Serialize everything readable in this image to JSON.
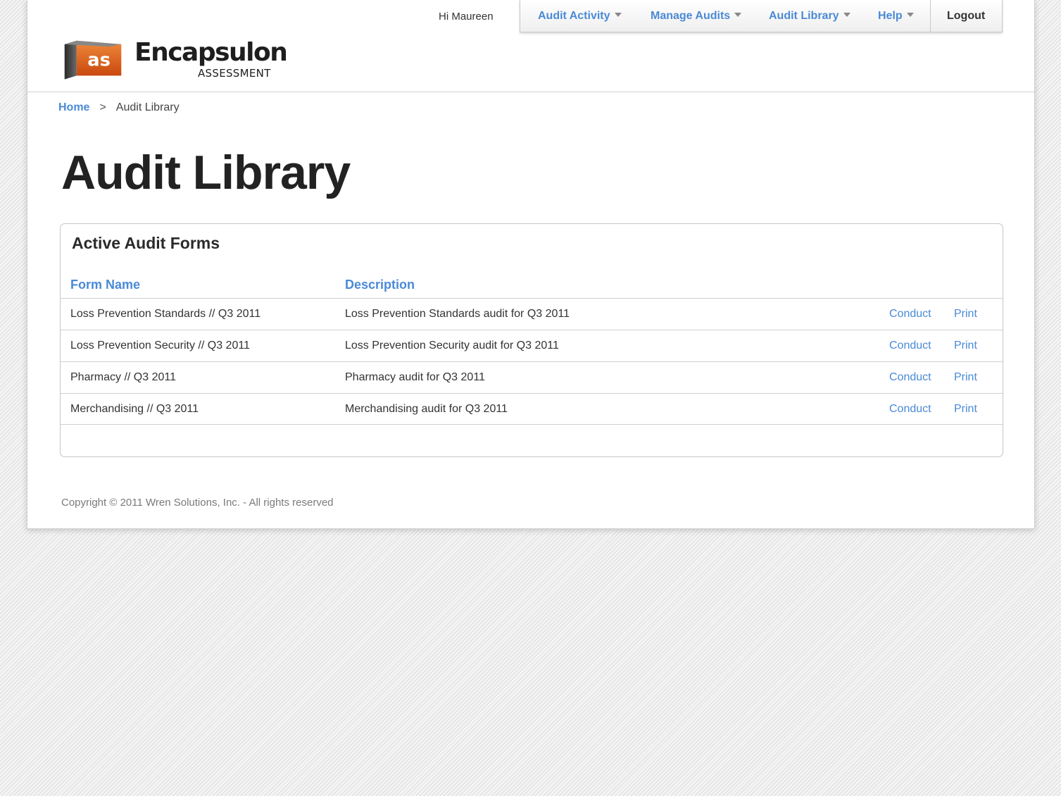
{
  "header": {
    "logo_text": "Encapsulon",
    "logo_subtext": "ASSESSMENT",
    "logo_badge": "as",
    "greeting": "Hi Maureen"
  },
  "nav": {
    "items": [
      {
        "label": "Audit Activity"
      },
      {
        "label": "Manage Audits"
      },
      {
        "label": "Audit Library"
      },
      {
        "label": "Help"
      }
    ],
    "logout": "Logout"
  },
  "breadcrumb": {
    "home": "Home",
    "separator": ">",
    "current": "Audit Library"
  },
  "page_title": "Audit Library",
  "panel": {
    "title": "Active Audit Forms",
    "columns": [
      "Form Name",
      "Description"
    ],
    "rows": [
      {
        "name": "Loss Prevention Standards  //  Q3 2011",
        "description": "Loss Prevention Standards audit for Q3 2011",
        "conduct": "Conduct",
        "print": "Print"
      },
      {
        "name": "Loss Prevention Security  //  Q3 2011",
        "description": "Loss Prevention Security audit for Q3 2011",
        "conduct": "Conduct",
        "print": "Print"
      },
      {
        "name": "Pharmacy  //  Q3 2011",
        "description": "Pharmacy audit for Q3 2011",
        "conduct": "Conduct",
        "print": "Print"
      },
      {
        "name": "Merchandising  //  Q3 2011",
        "description": "Merchandising audit for Q3 2011",
        "conduct": "Conduct",
        "print": "Print"
      }
    ]
  },
  "footer": "Copyright © 2011 Wren Solutions, Inc. - All rights reserved",
  "colors": {
    "link": "#4a8ad6",
    "logo_orange": "#e8641b"
  }
}
